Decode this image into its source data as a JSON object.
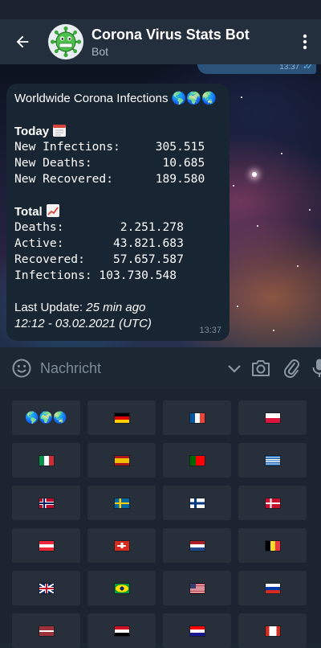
{
  "header": {
    "title": "Corona Virus Stats Bot",
    "subtitle": "Bot"
  },
  "sent_message": {
    "text": "🌎🌍🌏",
    "time": "13:37"
  },
  "message": {
    "heading": "Worldwide Corona Infections 🌎🌍🌏",
    "today_label": "Today",
    "today_icon": "calendar-icon",
    "today_rows": [
      "New Infections:     305.515",
      "New Deaths:          10.685",
      "New Recovered:      189.580"
    ],
    "total_label": "Total",
    "total_icon": "chart-increasing-icon",
    "total_rows": [
      "Deaths:        2.251.278",
      "Active:       43.821.683",
      "Recovered:    57.657.587",
      "Infections: 103.730.548"
    ],
    "last_update_label": "Last Update:",
    "last_update_value": "25 min ago",
    "timestamp": "12:12 - 03.02.2021 (UTC)",
    "time": "13:37"
  },
  "composer": {
    "placeholder": "Nachricht"
  },
  "keyboard": {
    "buttons": [
      {
        "label": "🌎🌍🌏",
        "flag": null
      },
      {
        "label": "",
        "flag": "de"
      },
      {
        "label": "",
        "flag": "fr"
      },
      {
        "label": "",
        "flag": "pl"
      },
      {
        "label": "",
        "flag": "it"
      },
      {
        "label": "",
        "flag": "es"
      },
      {
        "label": "",
        "flag": "pt"
      },
      {
        "label": "",
        "flag": "gr"
      },
      {
        "label": "",
        "flag": "no"
      },
      {
        "label": "",
        "flag": "se"
      },
      {
        "label": "",
        "flag": "fi"
      },
      {
        "label": "",
        "flag": "dk"
      },
      {
        "label": "",
        "flag": "at"
      },
      {
        "label": "",
        "flag": "ch"
      },
      {
        "label": "",
        "flag": "nl"
      },
      {
        "label": "",
        "flag": "be"
      },
      {
        "label": "",
        "flag": "gb"
      },
      {
        "label": "",
        "flag": "br"
      },
      {
        "label": "",
        "flag": "us"
      },
      {
        "label": "",
        "flag": "ru"
      },
      {
        "label": "",
        "flag": "lv"
      },
      {
        "label": "",
        "flag": "eg"
      },
      {
        "label": "",
        "flag": "hr"
      },
      {
        "label": "",
        "flag": "ca"
      }
    ]
  },
  "colors": {
    "header_bg": "#242f3d",
    "bubble_bg": "#182533",
    "sent_bg": "#2b5278",
    "keyboard_btn": "#262f3a",
    "accent": "#64b5ef"
  }
}
